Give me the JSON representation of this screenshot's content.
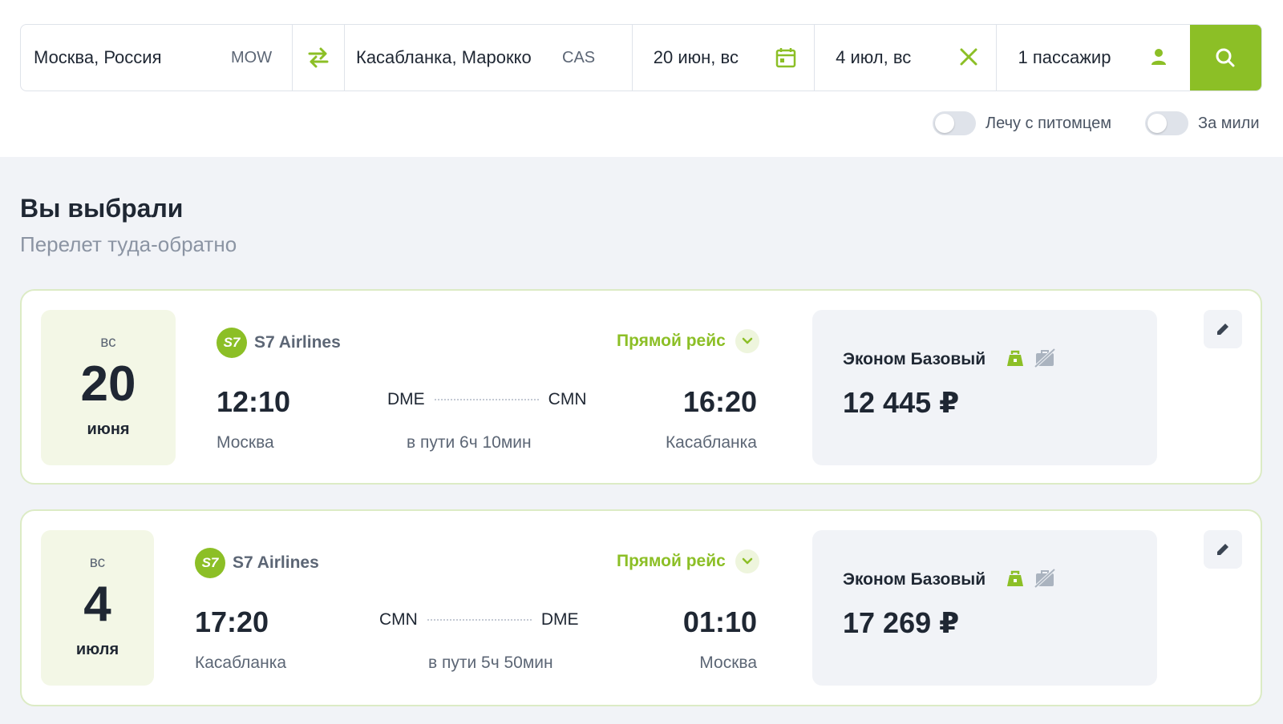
{
  "search": {
    "from_city": "Москва, Россия",
    "from_code": "MOW",
    "to_city": "Касабланка, Марокко",
    "to_code": "CAS",
    "depart_date": "20 июн, вс",
    "return_date": "4 июл, вс",
    "passengers": "1 пассажир"
  },
  "options": {
    "pet_label": "Лечу с питомцем",
    "miles_label": "За мили",
    "pet_on": false,
    "miles_on": false
  },
  "heading": {
    "title": "Вы выбрали",
    "subtitle": "Перелет туда-обратно"
  },
  "flights": [
    {
      "dow": "вс",
      "day": "20",
      "month": "июня",
      "airline": "S7 Airlines",
      "airline_logo_text": "S7",
      "direct_label": "Прямой рейс",
      "dep_time": "12:10",
      "dep_city": "Москва",
      "dep_airport": "DME",
      "arr_airport": "CMN",
      "duration": "в пути 6ч 10мин",
      "arr_time": "16:20",
      "arr_city": "Касабланка",
      "fare_name": "Эконом Базовый",
      "price": "12 445 ₽"
    },
    {
      "dow": "вс",
      "day": "4",
      "month": "июля",
      "airline": "S7 Airlines",
      "airline_logo_text": "S7",
      "direct_label": "Прямой рейс",
      "dep_time": "17:20",
      "dep_city": "Касабланка",
      "dep_airport": "CMN",
      "arr_airport": "DME",
      "duration": "в пути 5ч 50мин",
      "arr_time": "01:10",
      "arr_city": "Москва",
      "fare_name": "Эконом Базовый",
      "price": "17 269 ₽"
    }
  ],
  "colors": {
    "accent": "#8cbf26",
    "text": "#1f2733",
    "muted": "#5c6675",
    "page_bg": "#f1f3f7"
  },
  "icons": {
    "swap": "swap-arrows-icon",
    "calendar": "calendar-icon",
    "clear": "close-icon",
    "passenger": "person-icon",
    "search": "search-icon",
    "direct": "chevron-down-icon",
    "baggage": "carry-on-bag-icon",
    "no_checked_bag": "no-baggage-icon",
    "edit": "pencil-icon"
  }
}
